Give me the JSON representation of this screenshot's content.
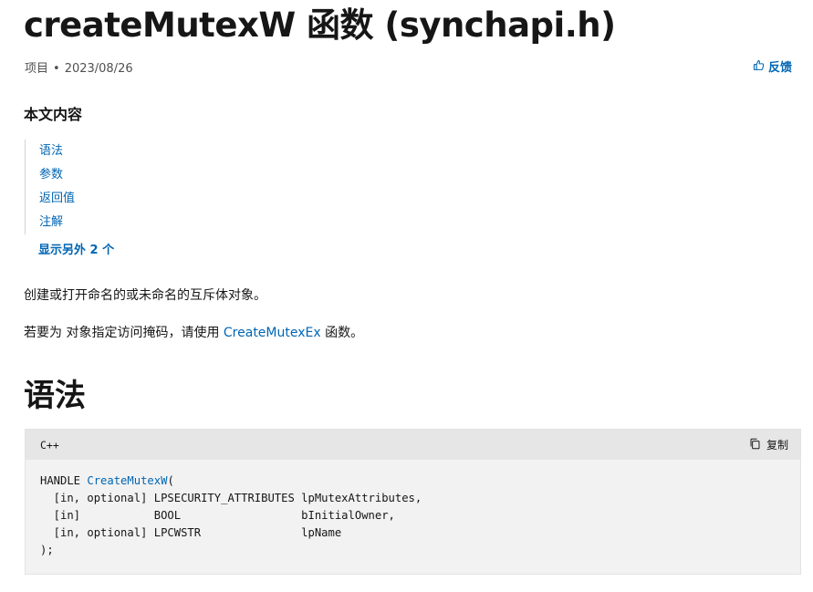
{
  "article": {
    "title": "createMutexW 函数 (synchapi.h)",
    "meta_type": "项目",
    "meta_separator": "•",
    "date": "2023/08/26",
    "feedback_label": "反馈"
  },
  "toc": {
    "heading": "本文内容",
    "items": [
      {
        "label": "语法"
      },
      {
        "label": "参数"
      },
      {
        "label": "返回值"
      },
      {
        "label": "注解"
      }
    ],
    "show_more": "显示另外 2 个"
  },
  "body": {
    "description": "创建或打开命名的或未命名的互斥体对象。",
    "note_prefix": "若要为 对象指定访问掩码，请使用 ",
    "note_link": "CreateMutexEx",
    "note_suffix": " 函数。"
  },
  "syntax": {
    "heading": "语法",
    "language": "C++",
    "copy_label": "复制",
    "code": {
      "line1_prefix": "HANDLE ",
      "function_name": "CreateMutexW",
      "line1_suffix": "(",
      "line2": "  [in, optional] LPSECURITY_ATTRIBUTES lpMutexAttributes,",
      "line3": "  [in]           BOOL                  bInitialOwner,",
      "line4": "  [in, optional] LPCWSTR               lpName",
      "line5": ");"
    }
  },
  "colors": {
    "link": "#0065b3",
    "text": "#161616",
    "code_background": "#f2f2f2",
    "code_header_background": "#e6e6e6"
  }
}
